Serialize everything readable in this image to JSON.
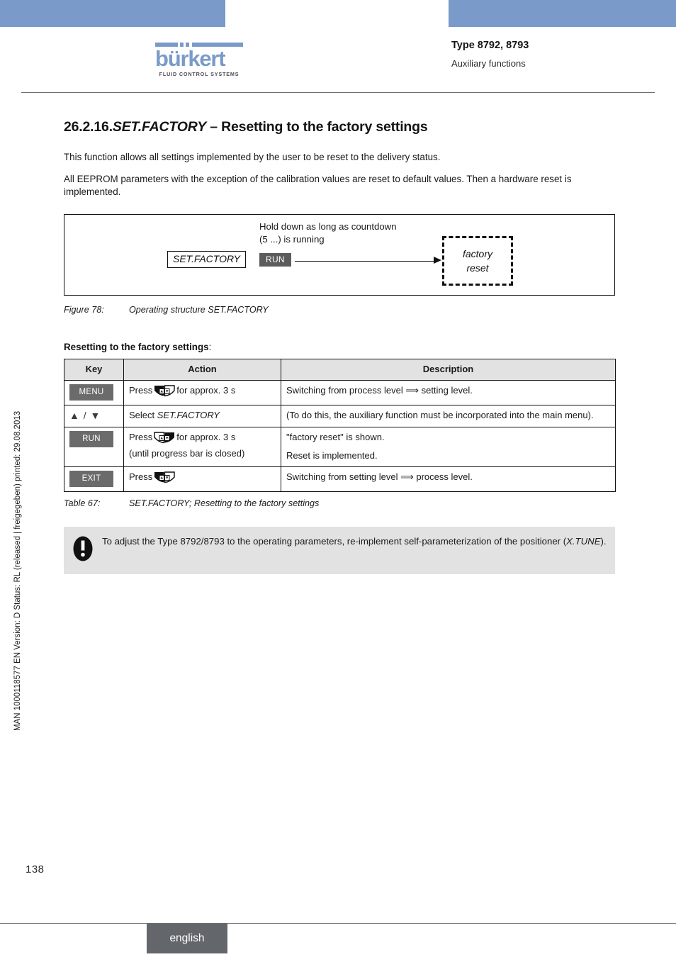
{
  "header": {
    "logo_word": "bürkert",
    "logo_tagline": "FLUID CONTROL SYSTEMS",
    "type_line": "Type 8792, 8793",
    "subtitle": "Auxiliary functions"
  },
  "side_note": "MAN 1000118577  EN  Version: D  Status: RL (released | freigegeben)  printed: 29.08.2013",
  "section": {
    "number": "26.2.16.",
    "code": "SET.FACTORY",
    "title_rest": " – Resetting to the factory settings",
    "paragraph_1": "This function allows all settings implemented by the user to be reset to the delivery status.",
    "paragraph_2": "All EEPROM parameters with the exception of the calibration values are reset to default values. Then a hardware reset is implemented."
  },
  "figure": {
    "state_label": "SET.FACTORY",
    "hold_line_1": "Hold down as long as countdown",
    "hold_line_2": "(5 ...) is running",
    "run_label": "RUN",
    "target_line_1": "factory",
    "target_line_2": "reset",
    "caption_number": "Figure 78:",
    "caption_text": "Operating structure SET.FACTORY"
  },
  "subheading": {
    "text": "Resetting to the factory settings",
    "colon": ":"
  },
  "table": {
    "headers": [
      "Key",
      "Action",
      "Description"
    ],
    "rows": [
      {
        "key_badge": "MENU",
        "key_type": "badge",
        "icon": "key-press-left-icon",
        "action_prefix": "Press",
        "action_suffix": "for approx. 3 s",
        "action_line_2": "",
        "desc_line_1": "Switching from process level ⟹ setting level.",
        "desc_line_2": ""
      },
      {
        "key_badge": "▲ / ▼",
        "key_type": "triangles",
        "icon": "",
        "action_prefix": "Select",
        "action_italic": "SET.FACTORY",
        "action_suffix": "",
        "action_line_2": "",
        "desc_line_1": "(To do this, the auxiliary function must be incorporated into the main menu).",
        "desc_line_2": ""
      },
      {
        "key_badge": "RUN",
        "key_type": "badge",
        "icon": "key-press-right-icon",
        "action_prefix": "Press",
        "action_suffix": "for approx. 3 s",
        "action_line_2": "(until progress bar is closed)",
        "desc_line_1": "\"factory reset\" is shown.",
        "desc_line_2": "Reset is implemented."
      },
      {
        "key_badge": "EXIT",
        "key_type": "badge",
        "icon": "key-press-left-icon",
        "action_prefix": "Press",
        "action_suffix": "",
        "action_line_2": "",
        "desc_line_1": "Switching from setting level ⟹ process level.",
        "desc_line_2": ""
      }
    ],
    "caption_number": "Table 67:",
    "caption_text": "SET.FACTORY; Resetting to the factory settings"
  },
  "note": {
    "icon": "exclamation-icon",
    "line_1": "To adjust the Type 8792/8793 to the operating parameters, re-implement self-parameterization of the",
    "line_2_prefix": "positioner (",
    "line_2_italic": "X.TUNE",
    "line_2_suffix": ")."
  },
  "footer": {
    "page_number": "138",
    "language_tab": "english"
  },
  "colors": {
    "brand_blue": "#7a9bc9",
    "badge_gray": "#6b6b6b",
    "note_bg": "#e2e2e2",
    "table_header_bg": "#e2e2e2",
    "footer_tab": "#63666b"
  }
}
